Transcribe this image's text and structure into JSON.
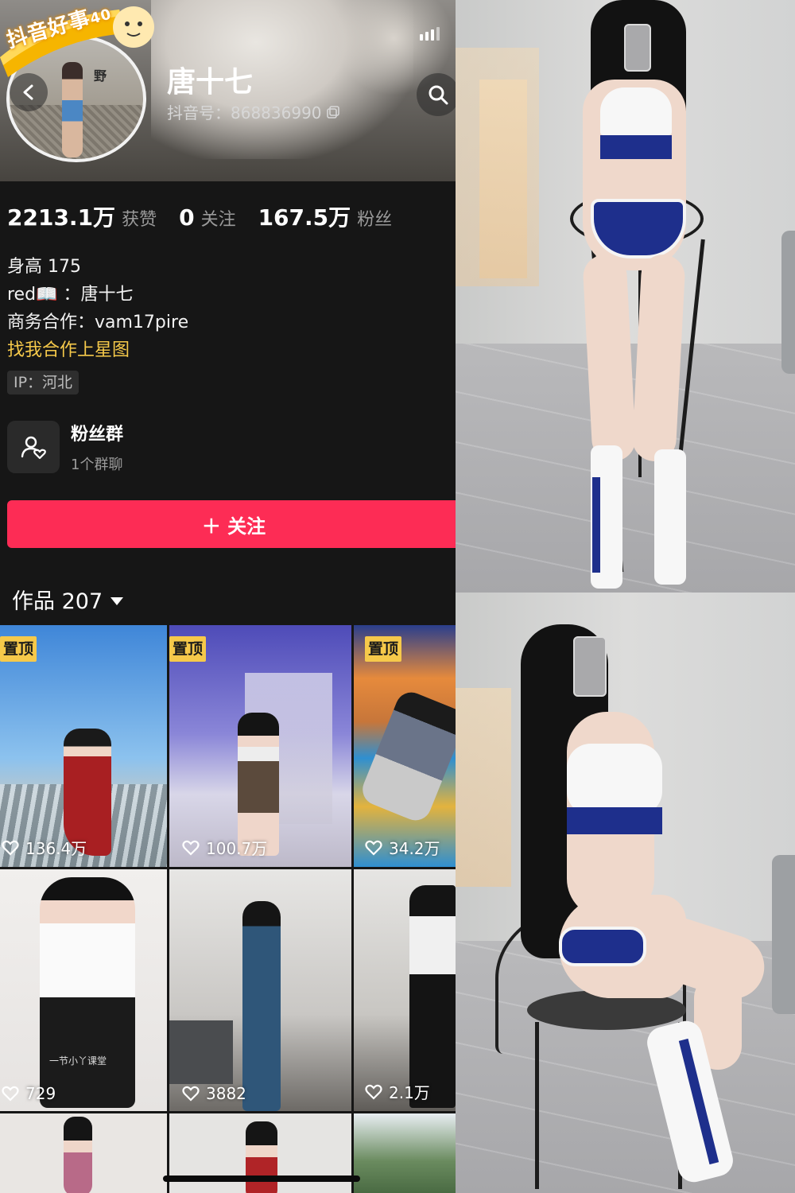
{
  "profile": {
    "badge_text": "抖音好事",
    "badge_number": "40",
    "avatar_sign": "野",
    "name": "唐十七",
    "uid": "抖音号：868836990",
    "stats": [
      {
        "num": "2213.1万",
        "label": "获赞"
      },
      {
        "num": "0",
        "label": "关注"
      },
      {
        "num": "167.5万",
        "label": "粉丝"
      }
    ],
    "bio": {
      "line1": "身高 175",
      "line2": "red📖 ：唐十七",
      "line3": "商务合作：vam17pire",
      "line4": "找我合作上星图"
    },
    "ip": "IP：河北",
    "fan_group": {
      "title": "粉丝群",
      "subtitle": "1个群聊"
    },
    "follow_label": "＋ 关注",
    "works_label": "作品 207"
  },
  "works": [
    {
      "pinned": "置顶",
      "likes": "136.4万"
    },
    {
      "pinned": "置顶",
      "likes": "100.7万"
    },
    {
      "pinned": "置顶",
      "likes": "34.2万"
    },
    {
      "pinned": "",
      "likes": "729",
      "caption": "一节小丫课堂"
    },
    {
      "pinned": "",
      "likes": "3882"
    },
    {
      "pinned": "",
      "likes": "2.1万"
    },
    {
      "pinned": "",
      "likes": ""
    },
    {
      "pinned": "",
      "likes": ""
    },
    {
      "pinned": "",
      "likes": ""
    }
  ],
  "colors": {
    "follow_button": "#fd2c55",
    "pin_badge": "#f6c94a",
    "background": "#161616",
    "link_text": "#f6c94a"
  },
  "icons": [
    "back-icon",
    "search-icon",
    "copy-icon",
    "fan-group-icon",
    "heart-icon",
    "caret-down-icon",
    "signal-icon"
  ]
}
